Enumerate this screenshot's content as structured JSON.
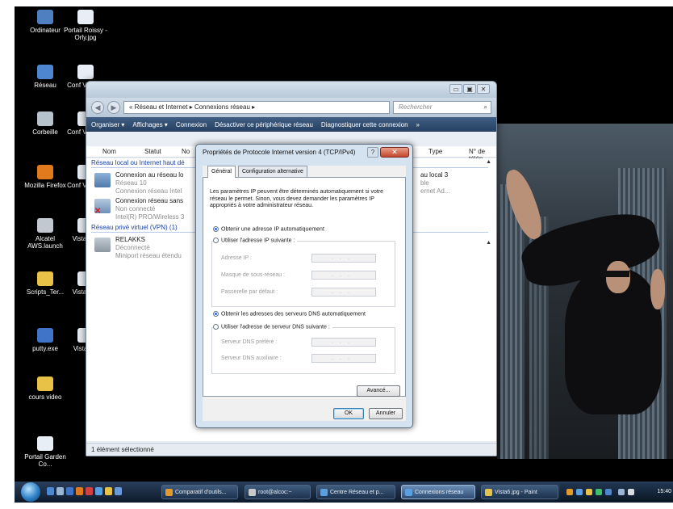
{
  "desktop": {
    "icons": [
      {
        "label": "Ordinateur",
        "color": "#4f7fc0"
      },
      {
        "label": "Portail Roissy - Orly.jpg",
        "color": "#e8eef6"
      },
      {
        "label": "Réseau",
        "color": "#4f86d0"
      },
      {
        "label": "Conf Vi 1.jpg",
        "color": "#e8eef6"
      },
      {
        "label": "Corbeille",
        "color": "#b7c3cc"
      },
      {
        "label": "Conf Vi 2.jpg",
        "color": "#e8eef6"
      },
      {
        "label": "Mozilla Firefox",
        "color": "#e07a1c"
      },
      {
        "label": "Conf Vi 3.jpg",
        "color": "#e8eef6"
      },
      {
        "label": "Alcatel AWS.launch",
        "color": "#c2c8cf"
      },
      {
        "label": "Vista 4.jp",
        "color": "#e8eef6"
      },
      {
        "label": "Scripts_Ter...",
        "color": "#e8c246"
      },
      {
        "label": "Vista 5.jp",
        "color": "#e8eef6"
      },
      {
        "label": "putty.exe",
        "color": "#3f74c9"
      },
      {
        "label": "Vista6.jp",
        "color": "#e8eef6"
      },
      {
        "label": "cours video",
        "color": "#e8c246"
      },
      {
        "label": "Portail Garden Co...",
        "color": "#e8eef6"
      }
    ]
  },
  "explorer": {
    "window_buttons": [
      "▭",
      "▣",
      "✕"
    ],
    "nav_back": "◀",
    "nav_forward": "▶",
    "address": "« Réseau et Internet ▸ Connexions réseau ▸",
    "search_placeholder": "Rechercher",
    "search_icon": "⌕",
    "toolbar": [
      "Organiser ▾",
      "Affichages ▾",
      "Connexion",
      "Désactiver ce périphérique réseau",
      "Diagnostiquer cette connexion",
      "»"
    ],
    "columns": [
      "Nom",
      "Statut",
      "No",
      "Type",
      "N° de télép..."
    ],
    "groups": [
      {
        "label": "Réseau local ou Internet haut dé"
      },
      {
        "label": "Réseau privé virtuel (VPN) (1)"
      }
    ],
    "items": [
      {
        "name": "Connexion au réseau lo",
        "line2": "Réseau 10",
        "line3": "Connexion réseau Intel"
      },
      {
        "name": "Connexion réseau sans",
        "line2": "Non connecté",
        "line3": "Intel(R) PRO/Wireless 3"
      },
      {
        "name": "RELAKKS",
        "line2": "Déconnecté",
        "line3": "Miniport réseau étendu"
      }
    ],
    "right_column": {
      "line1": "au local 3",
      "line2": "ble",
      "line3": "ernet Ad..."
    },
    "status": "1 élément sélectionné"
  },
  "dialog": {
    "title": "Propriétés de Protocole Internet version 4 (TCP/IPv4)",
    "help_button": "?",
    "close_button": "✕",
    "tabs": [
      "Général",
      "Configuration alternative"
    ],
    "description": "Les paramètres IP peuvent être déterminés automatiquement si votre réseau le permet. Sinon, vous devez demander les paramètres IP appropriés à votre administrateur réseau.",
    "ip_auto": "Obtenir une adresse IP automatiquement",
    "ip_manual": "Utiliser l'adresse IP suivante :",
    "ip_fields": [
      "Adresse IP :",
      "Masque de sous-réseau :",
      "Passerelle par défaut :"
    ],
    "dns_auto": "Obtenir les adresses des serveurs DNS automatiquement",
    "dns_manual": "Utiliser l'adresse de serveur DNS suivante :",
    "dns_fields": [
      "Serveur DNS préféré :",
      "Serveur DNS auxiliaire :"
    ],
    "field_placeholder": "...",
    "advanced_button": "Avancé...",
    "ok_button": "OK",
    "cancel_button": "Annuler"
  },
  "taskbar": {
    "tasks": [
      {
        "label": "Comparatif d'outils...",
        "color": "#e39a2c"
      },
      {
        "label": "root@alcoc:~",
        "color": "#c9c9c9"
      },
      {
        "label": "Centre Réseau et p...",
        "color": "#5aa0e0"
      },
      {
        "label": "Connexions réseau",
        "color": "#5aa0e0"
      },
      {
        "label": "Vista6.jpg - Paint",
        "color": "#e5c34a"
      }
    ],
    "clock": "15:40"
  }
}
